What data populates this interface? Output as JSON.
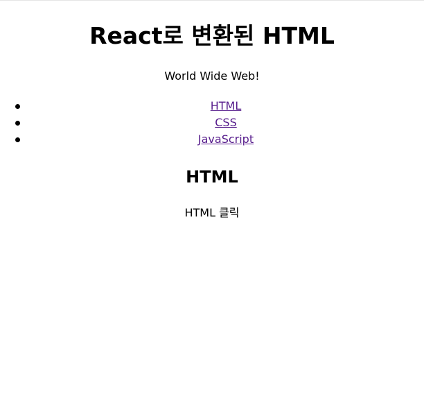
{
  "header": {
    "title": "React로 변환된 HTML",
    "tagline": "World Wide Web!"
  },
  "nav": {
    "items": [
      {
        "label": "HTML"
      },
      {
        "label": "CSS"
      },
      {
        "label": "JavaScript"
      }
    ]
  },
  "article": {
    "title": "HTML",
    "body": "HTML 클릭"
  },
  "colors": {
    "link_visited": "#551a8b",
    "text": "#000000",
    "background": "#ffffff"
  }
}
